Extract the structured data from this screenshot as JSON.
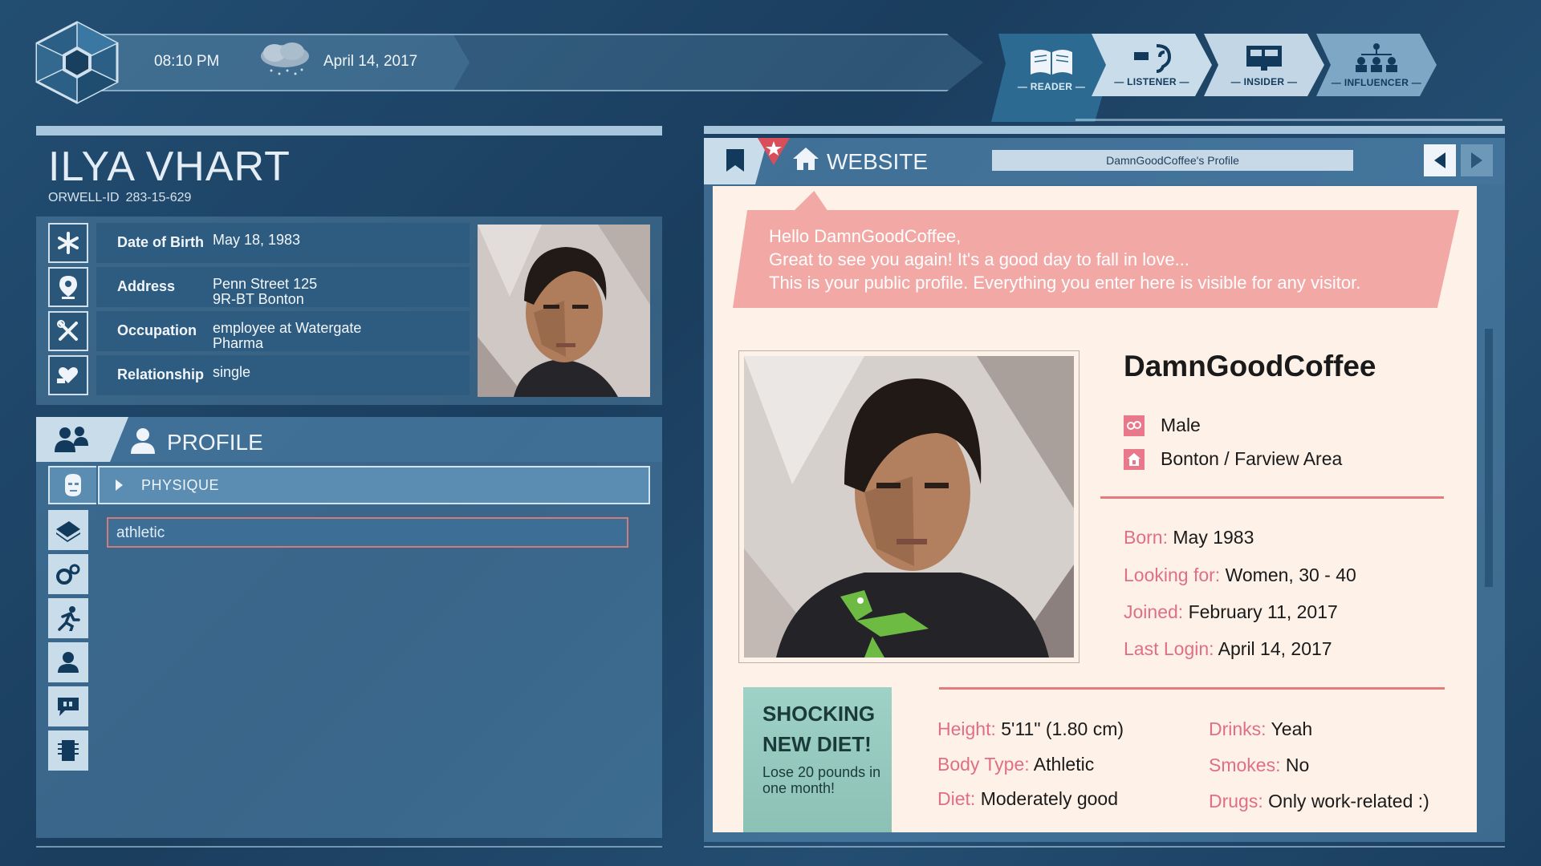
{
  "topbar": {
    "time": "08:10 PM",
    "date": "April 14, 2017",
    "weather_icon": "cloud-rain-icon",
    "ranks": [
      {
        "label": "— READER —",
        "icon": "book-icon"
      },
      {
        "label": "— LISTENER —",
        "icon": "ear-icon"
      },
      {
        "label": "— INSIDER —",
        "icon": "monitor-icon"
      },
      {
        "label": "— INFLUENCER —",
        "icon": "hierarchy-icon"
      }
    ]
  },
  "person": {
    "name": "ILYA VHART",
    "orwell_label": "ORWELL-ID",
    "orwell_id": "283-15-629",
    "fields": [
      {
        "key": "Date of Birth",
        "value": "May 18, 1983",
        "icon": "asterisk-icon"
      },
      {
        "key": "Address",
        "value": "Penn Street 125\n9R-BT Bonton",
        "icon": "location-pin-icon"
      },
      {
        "key": "Occupation",
        "value": "employee at Watergate\nPharma",
        "icon": "tools-icon"
      },
      {
        "key": "Relationship",
        "value": "single",
        "icon": "heart-hand-icon"
      }
    ]
  },
  "profile": {
    "title": "PROFILE",
    "category": "PHYSIQUE",
    "value": "athletic"
  },
  "browser": {
    "title": "WEBSITE",
    "url": "DamnGoodCoffee's Profile"
  },
  "site": {
    "greeting": [
      "Hello DamnGoodCoffee,",
      "Great to see you again! It's a good day to fall in love...",
      "This is your public profile. Everything you enter here is visible for any visitor."
    ],
    "username": "DamnGoodCoffee",
    "gender": "Male",
    "area": "Bonton / Farview Area",
    "facts": [
      {
        "k": "Born:",
        "v": "May 1983"
      },
      {
        "k": "Looking for:",
        "v": "Women, 30 - 40"
      },
      {
        "k": "Joined:",
        "v": "February 11, 2017"
      },
      {
        "k": "Last Login:",
        "v": "April 14, 2017"
      }
    ],
    "details_left": [
      {
        "k": "Height:",
        "v": "5'11\" (1.80 cm)"
      },
      {
        "k": "Body Type:",
        "v": "Athletic"
      },
      {
        "k": "Diet:",
        "v": "Moderately good"
      }
    ],
    "details_right": [
      {
        "k": "Drinks:",
        "v": "Yeah"
      },
      {
        "k": "Smokes:",
        "v": "No"
      },
      {
        "k": "Drugs:",
        "v": "Only work-related :)"
      }
    ],
    "ad_title_1": "SHOCKING",
    "ad_title_2": "NEW DIET!",
    "ad_sub": "Lose 20 pounds in one month!"
  },
  "colors": {
    "accent": "#e06f84",
    "panel": "#2d5c80",
    "page_bg": "#fdf1e8"
  }
}
